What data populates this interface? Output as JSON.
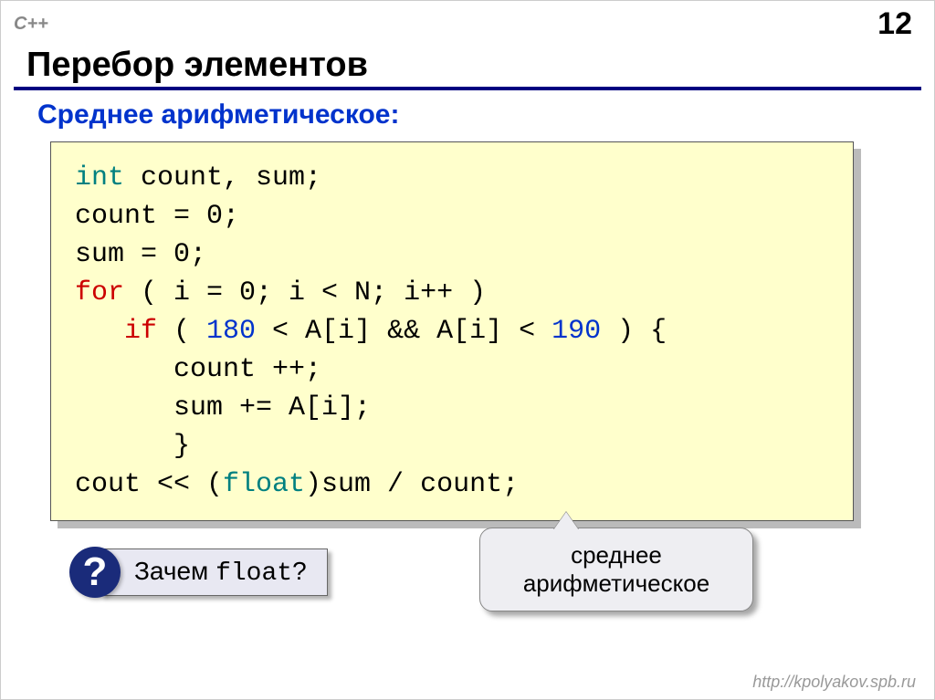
{
  "header": {
    "lang": "C++",
    "slide_number": "12"
  },
  "title": "Перебор элементов",
  "subtitle": "Среднее арифметическое:",
  "code": {
    "l1a": "int",
    "l1b": " count, sum;",
    "l2": "count = 0;",
    "l3": "sum = 0;",
    "l4a": "for",
    "l4b": " ( i = 0; i < N; i++ )",
    "l5a": "   if",
    "l5b": " ( ",
    "l5c": "180",
    "l5d": " < A[i] && A[i] < ",
    "l5e": "190",
    "l5f": " ) {",
    "l6": "      count ++;",
    "l7": "      sum += A[i];",
    "l8": "      }",
    "l9a": "cout << (",
    "l9b": "float",
    "l9c": ")sum / count;"
  },
  "question": {
    "mark": "?",
    "prefix": "Зачем ",
    "kw": "float",
    "suffix": "?"
  },
  "callout": {
    "line1": "среднее",
    "line2": "арифметическое"
  },
  "footer": "http://kpolyakov.spb.ru"
}
